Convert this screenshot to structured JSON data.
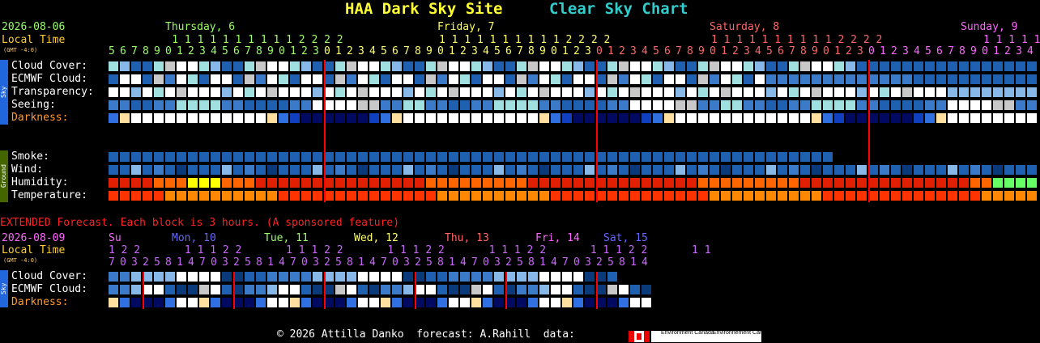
{
  "title": {
    "site": "HAA Dark Sky Site",
    "chart": "Clear Sky Chart"
  },
  "main": {
    "date": "2026-08-06",
    "local_time": "Local Time",
    "gmt": "(GMT -4:0)",
    "days": [
      {
        "label": "Thursday, 6",
        "color": "#99ff66"
      },
      {
        "label": "Friday, 7",
        "color": "#ffff66"
      },
      {
        "label": "Saturday, 8",
        "color": "#ff6666"
      },
      {
        "label": "Sunday, 9",
        "color": "#ff66ff"
      }
    ],
    "hour_tens": [
      "          1 1 1 1 1 1 1 1 1 1 2 2 2 2",
      "1 1 1 1 1 1 1 1 1 1 2 2 2 2",
      "1 1 1 1 1 1 1 1 1 1 2 2 2 2",
      "1 1 1 1 1"
    ],
    "hour_ones": "5 6 7 8 9 0 1 2 3 4 5 6 7 8 9 0 1 2 3 0 1 2 3 4 5 6 7 8 9 0 1 2 3 4 5 6 7 8 9 0 1 2 3 0 1 2 3 4 5 6 7 8 9 0 1 2 3 4 5 6 7 8 9 0 1 2 3 0 1 2 3 4 5 6 7 8 9 0 1 2 3 4",
    "sky_tab": "Sky",
    "ground_tab": "Ground",
    "rows": {
      "cloud": "Cloud Cover:",
      "ecmwf": "ECMWF Cloud:",
      "transparency": "Transparency:",
      "seeing": "Seeing:",
      "darkness": "Darkness:",
      "smoke": "Smoke:",
      "wind": "Wind:",
      "humidity": "Humidity:",
      "temperature": "Temperature:"
    }
  },
  "extended": {
    "heading": "EXTENDED Forecast. Each block is 3 hours. (A sponsored feature)",
    "date": "2026-08-09",
    "local_time": "Local Time",
    "gmt": "(GMT -4:0)",
    "days": [
      {
        "label": "Su",
        "color": "#ff66ff"
      },
      {
        "label": "Mon, 10",
        "color": "#6666ff"
      },
      {
        "label": "Tue, 11",
        "color": "#99ff66"
      },
      {
        "label": "Wed, 12",
        "color": "#ffff66"
      },
      {
        "label": "Thu, 13",
        "color": "#ff6666"
      },
      {
        "label": "Fri, 14",
        "color": "#ff66ff"
      },
      {
        "label": "Sat, 15",
        "color": "#6666ff"
      }
    ],
    "hour_tens": "1 2 2       1 1 1 2 2       1 1 1 2 2       1 1 1 2 2       1 1 1 2 2       1 1 1 2 2       1 1",
    "hour_ones": "7 0 3 2 5 8 1 4 7 0 3 2 5 8 1 4 7 0 3 2 5 8 1 4 7 0 3 2 5 8 1 4 7 0 3 2 5 8 1 4 7 0 3 2 5 8 1 4",
    "rows": {
      "cloud": "Cloud Cover:",
      "ecmwf": "ECMWF Cloud:",
      "darkness": "Darkness:"
    }
  },
  "footer": {
    "text": "© 2026 Attilla Danko  forecast: A.Rahill  data:",
    "env1": "Environment Canada",
    "env2": "Environnement Canada"
  },
  "palette": {
    "dark": "#0a3a7a",
    "blue": "#2060b0",
    "mid": "#3a7ac8",
    "light": "#88b8e8",
    "cyan": "#a0e0e0",
    "white": "#ffffff",
    "gray": "#c8c8c8",
    "night": "#000a60",
    "twilight": "#1040c0",
    "dusk": "#3070e0",
    "orange": "#ff8800",
    "red": "#ff3300",
    "hum_red": "#e02000",
    "hum_orange": "#ff6600",
    "hum_yellow": "#ffff00",
    "green": "#66ff66"
  }
}
